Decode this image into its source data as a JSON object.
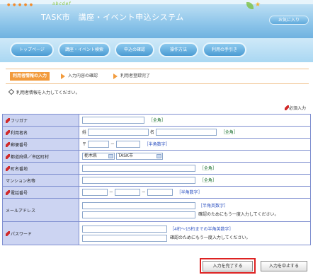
{
  "header": {
    "decoration": "abcdef",
    "title": "TASK市　講座・イベント申込システム",
    "favorite_label": "お気に入り"
  },
  "nav": {
    "items": [
      "トップページ",
      "講座・イベント検索",
      "申込の確認",
      "操作方法",
      "利用の手引き"
    ]
  },
  "steps": {
    "active": "利用者情報の入力",
    "step2": "入力内容の確認",
    "step3": "利用者登録完了"
  },
  "instruction": "利用者情報を入力してください。",
  "required_note": "必須入力",
  "form": {
    "furigana": {
      "label": "フリガナ",
      "hint": "［全角］"
    },
    "name": {
      "label": "利用者名",
      "sei": "姓",
      "mei": "名",
      "hint": "［全角］"
    },
    "postal": {
      "label": "郵便番号",
      "mark": "〒",
      "dash": "－",
      "hint": "［半角数字］"
    },
    "pref": {
      "label": "都道府県／市区町村",
      "pref_value": "栃木県",
      "city_value": "TASK市"
    },
    "address": {
      "label": "町名番地",
      "hint": "［全角］"
    },
    "building": {
      "label": "マンション名等",
      "hint": "［全角］"
    },
    "phone": {
      "label": "電話番号",
      "dash1": "－",
      "dash2": "－",
      "hint": "［半角数字］"
    },
    "email": {
      "label": "メールアドレス",
      "hint": "［半角英数字］",
      "confirm": "確認のためにもう一度入力してください。"
    },
    "password": {
      "label": "パスワード",
      "hint": "［4桁〜15桁までの半角英数字］",
      "confirm": "確認のためにもう一度入力してください。"
    }
  },
  "buttons": {
    "submit": "入力を完了する",
    "cancel": "入力を中止する"
  },
  "colors": {
    "accent": "#f29b3d",
    "label_bg": "#ccd4f2",
    "header_blue": "#6fb2e0",
    "focus_red": "#dd2222"
  }
}
